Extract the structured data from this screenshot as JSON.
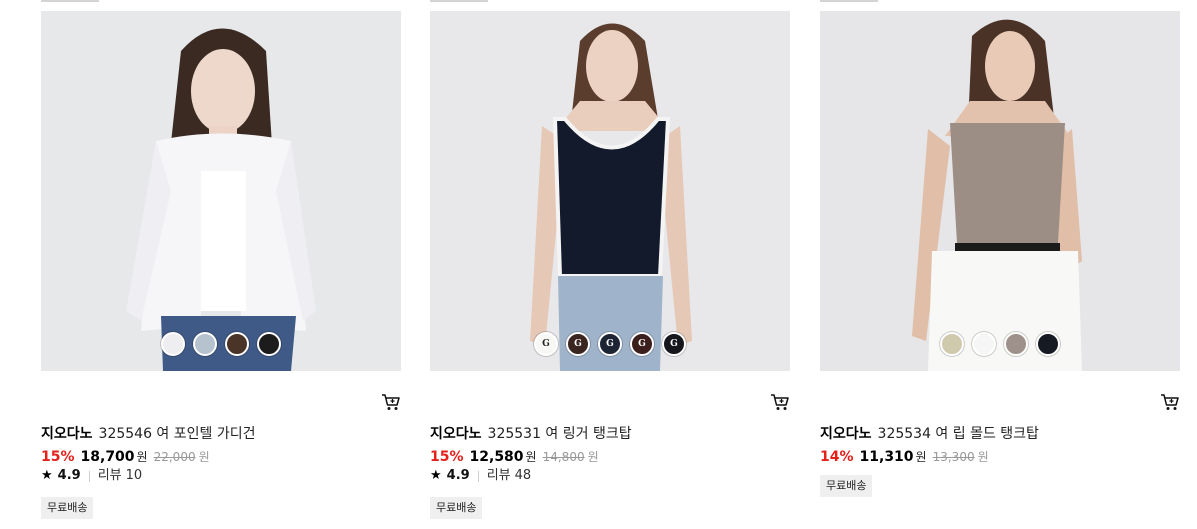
{
  "products": [
    {
      "brand": "지오다노",
      "name": "325546 여 포인텔 가디건",
      "discount": "15%",
      "price": "18,700",
      "currency": "원",
      "original_price": "22,000",
      "original_currency": "원",
      "rating_star": "★",
      "rating": "4.9",
      "review_label": "리뷰",
      "review_count": "10",
      "badge": "무료배송",
      "swatches": [
        {
          "color": "#eeeef0",
          "logo": ""
        },
        {
          "color": "#b7c2cf",
          "logo": ""
        },
        {
          "color": "#4a3428",
          "logo": ""
        },
        {
          "color": "#1c1c1c",
          "logo": ""
        }
      ]
    },
    {
      "brand": "지오다노",
      "name": "325531 여 링거 탱크탑",
      "discount": "15%",
      "price": "12,580",
      "currency": "원",
      "original_price": "14,800",
      "original_currency": "원",
      "rating_star": "★",
      "rating": "4.9",
      "review_label": "리뷰",
      "review_count": "48",
      "badge": "무료배송",
      "swatches": [
        {
          "color": "#f7f7f5",
          "logo": "G"
        },
        {
          "color": "#3a2520",
          "logo": "G"
        },
        {
          "color": "#1d2433",
          "logo": "G"
        },
        {
          "color": "#3b1f1c",
          "logo": "G"
        },
        {
          "color": "#15171c",
          "logo": "G"
        }
      ]
    },
    {
      "brand": "지오다노",
      "name": "325534 여 립 몰드 탱크탑",
      "discount": "14%",
      "price": "11,310",
      "currency": "원",
      "original_price": "13,300",
      "original_currency": "원",
      "badge": "무료배송",
      "swatches": [
        {
          "color": "#cfc9ae",
          "logo": ""
        },
        {
          "color": "#f6f6f6",
          "logo": ""
        },
        {
          "color": "#9e918b",
          "logo": ""
        },
        {
          "color": "#161a22",
          "logo": ""
        }
      ]
    }
  ]
}
